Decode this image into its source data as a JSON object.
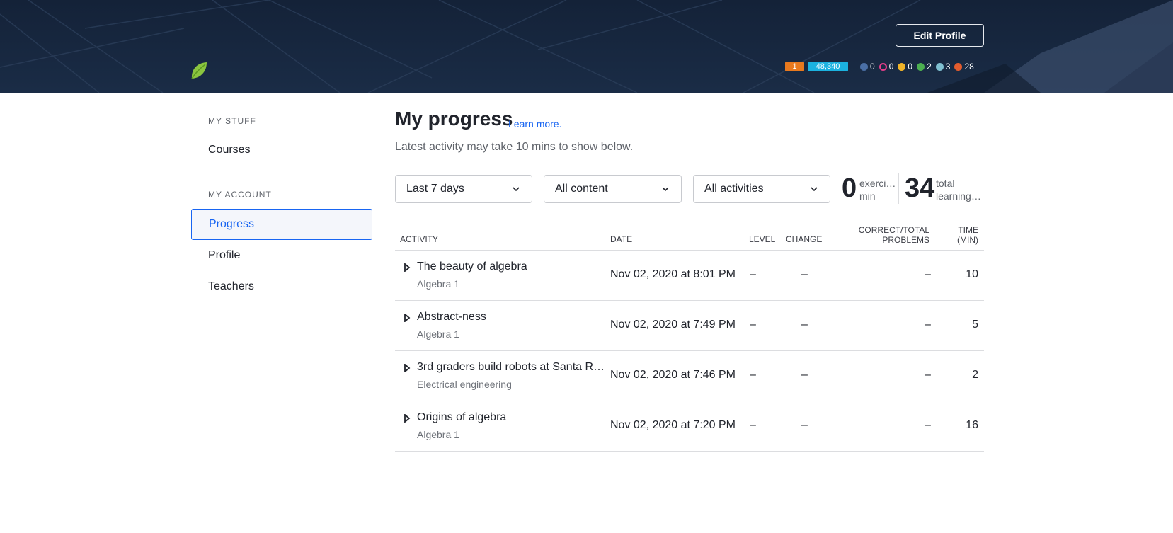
{
  "header": {
    "edit_profile_label": "Edit Profile",
    "level": "1",
    "points": "48,340",
    "badges": [
      {
        "icon": "meteorite-badge-icon",
        "count": "0",
        "color": "#4a6fa5"
      },
      {
        "icon": "moon-badge-icon",
        "count": "0",
        "color": "#e83e8c"
      },
      {
        "icon": "earth-badge-icon",
        "count": "0",
        "color": "#f0b429"
      },
      {
        "icon": "sun-badge-icon",
        "count": "2",
        "color": "#4caf50"
      },
      {
        "icon": "black-hole-badge-icon",
        "count": "3",
        "color": "#7fbfd0"
      },
      {
        "icon": "challenge-patch-icon",
        "count": "28",
        "color": "#e35c2e"
      }
    ]
  },
  "sidebar": {
    "my_stuff_heading": "MY STUFF",
    "courses_label": "Courses",
    "my_account_heading": "MY ACCOUNT",
    "items": [
      {
        "label": "Progress",
        "active": true
      },
      {
        "label": "Profile"
      },
      {
        "label": "Teachers"
      }
    ]
  },
  "main": {
    "title": "My progress",
    "learn_more": "Learn more.",
    "subtitle": "Latest activity may take 10 mins to show below.",
    "filters": {
      "time": "Last 7 days",
      "content": "All content",
      "activity": "All activities"
    },
    "kpis": {
      "exercise_value": "0",
      "exercise_label_1": "exerci…",
      "exercise_label_2": "min",
      "learning_value": "34",
      "learning_label_1": "total",
      "learning_label_2": "learning…"
    },
    "table": {
      "headers": {
        "activity": "ACTIVITY",
        "date": "DATE",
        "level": "LEVEL",
        "change": "CHANGE",
        "correct_1": "CORRECT/TOTAL",
        "correct_2": "PROBLEMS",
        "time_1": "TIME",
        "time_2": "(MIN)"
      },
      "rows": [
        {
          "title": "The beauty of algebra",
          "course": "Algebra 1",
          "date": "Nov 02, 2020 at 8:01 PM",
          "level": "–",
          "change": "–",
          "correct": "–",
          "time": "10"
        },
        {
          "title": "Abstract-ness",
          "course": "Algebra 1",
          "date": "Nov 02, 2020 at 7:49 PM",
          "level": "–",
          "change": "–",
          "correct": "–",
          "time": "5"
        },
        {
          "title": "3rd graders build robots at Santa R…",
          "course": "Electrical engineering",
          "date": "Nov 02, 2020 at 7:46 PM",
          "level": "–",
          "change": "–",
          "correct": "–",
          "time": "2"
        },
        {
          "title": "Origins of algebra",
          "course": "Algebra 1",
          "date": "Nov 02, 2020 at 7:20 PM",
          "level": "–",
          "change": "–",
          "correct": "–",
          "time": "16"
        }
      ]
    }
  }
}
